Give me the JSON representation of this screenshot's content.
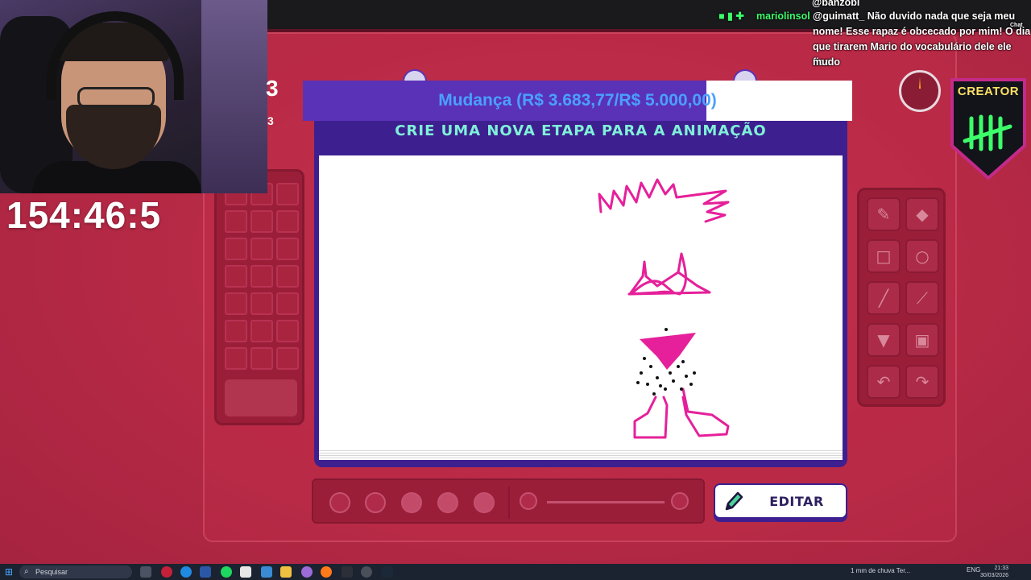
{
  "overlay": {
    "timer": "154:46:5",
    "side_numbers": [
      "3",
      "3"
    ]
  },
  "chat": {
    "top_user": "@banzobi",
    "username": "mariolinsol",
    "message_line1": "@guimatt_ Não duvido nada que seja meu",
    "message_line2": "nome! Esse rapaz é obcecado por mim! O dia",
    "message_line3": "que tirarem Mario do vocabulário dele ele fica",
    "message_line4": "mudo",
    "chat_button": "Chat"
  },
  "donation_goal": {
    "label": "Mudança (R$ 3.683,77/R$ 5.000,00)",
    "progress": 0.734,
    "fill_color": "#5a32b8",
    "text_color": "#4aa0ff"
  },
  "game": {
    "instruction": "CRIE UMA NOVA ETAPA PARA A ANIMAÇÃO",
    "edit_button": "EDITAR",
    "tools": [
      "pencil-icon",
      "eraser-icon",
      "rectangle-icon",
      "circle-icon",
      "line-icon",
      "eyedropper-icon",
      "fill-icon",
      "layer-icon",
      "undo-icon",
      "redo-icon"
    ],
    "frames_total": 5,
    "accent": "#3e1f8f",
    "title_color": "#7ff0d8"
  },
  "badge": {
    "label": "CREATOR"
  },
  "taskbar": {
    "search_placeholder": "Pesquisar",
    "weather": "1 mm de chuva Ter...",
    "language": "ENG",
    "time": "21:33",
    "date": "30/03/2026"
  }
}
